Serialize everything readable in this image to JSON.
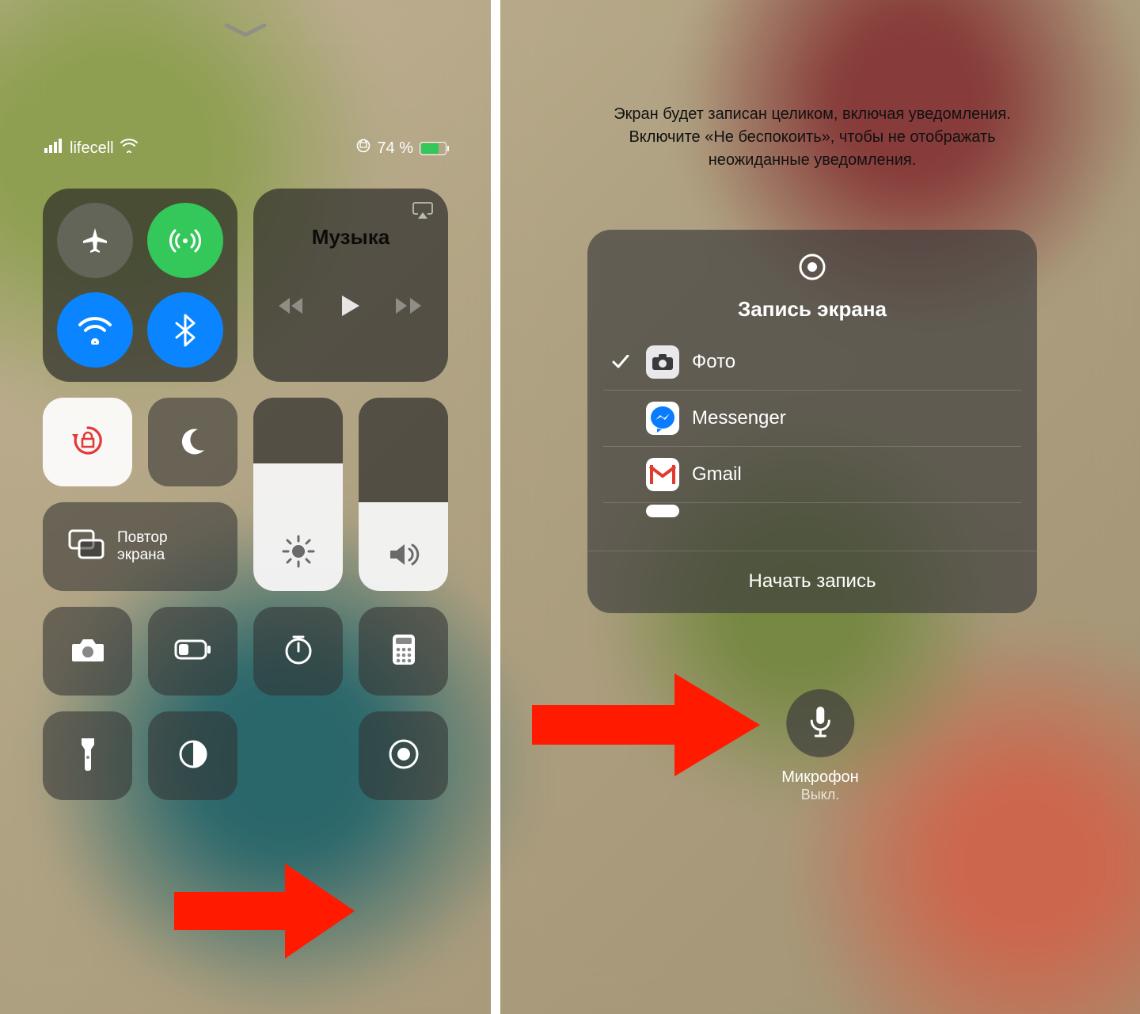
{
  "status": {
    "carrier": "lifecell",
    "battery_percent": "74 %"
  },
  "media": {
    "title": "Музыка"
  },
  "mirror": {
    "label": "Повтор экрана"
  },
  "sliders": {
    "brightness_pct": 66,
    "volume_pct": 46
  },
  "modal": {
    "title": "Запись экрана",
    "rows": [
      {
        "label": "Фото",
        "checked": true
      },
      {
        "label": "Messenger",
        "checked": false
      },
      {
        "label": "Gmail",
        "checked": false
      }
    ],
    "start": "Начать запись"
  },
  "notice": "Экран будет записан целиком, включая уведомления. Включите «Не беспокоить», чтобы не отображать неожиданные уведомления.",
  "mic": {
    "label": "Микрофон",
    "state": "Выкл."
  }
}
